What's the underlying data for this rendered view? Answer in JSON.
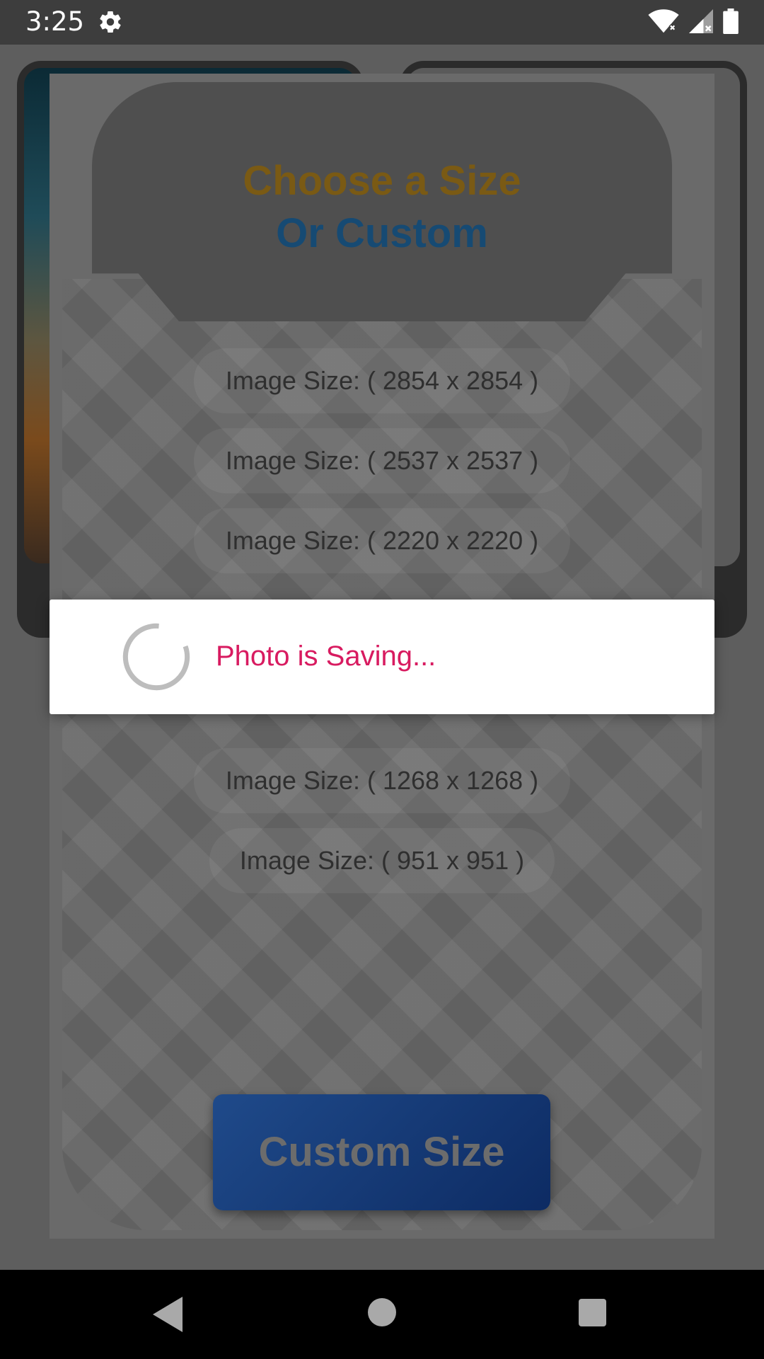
{
  "status_bar": {
    "time": "3:25",
    "icons": [
      "gear-icon",
      "wifi-icon",
      "signal-icon",
      "battery-icon"
    ]
  },
  "sheet": {
    "title_line1": "Choose a Size",
    "title_line2": "Or Custom",
    "sizes": [
      "Image Size: ( 2854 x 2854 )",
      "Image Size: ( 2537 x 2537 )",
      "Image Size: ( 2220 x 2220 )",
      "Image Size: ( 1268 x 1268 )",
      "Image Size: ( 951 x 951 )"
    ],
    "custom_button_label": "Custom Size"
  },
  "dialog": {
    "message": "Photo is Saving..."
  },
  "colors": {
    "title_line1": "#7a5a14",
    "title_line2": "#164a73",
    "dialog_text": "#d81b60",
    "custom_button": "#1f4a8a"
  },
  "nav_bar": {
    "icons": [
      "back-icon",
      "home-icon",
      "recents-icon"
    ]
  }
}
